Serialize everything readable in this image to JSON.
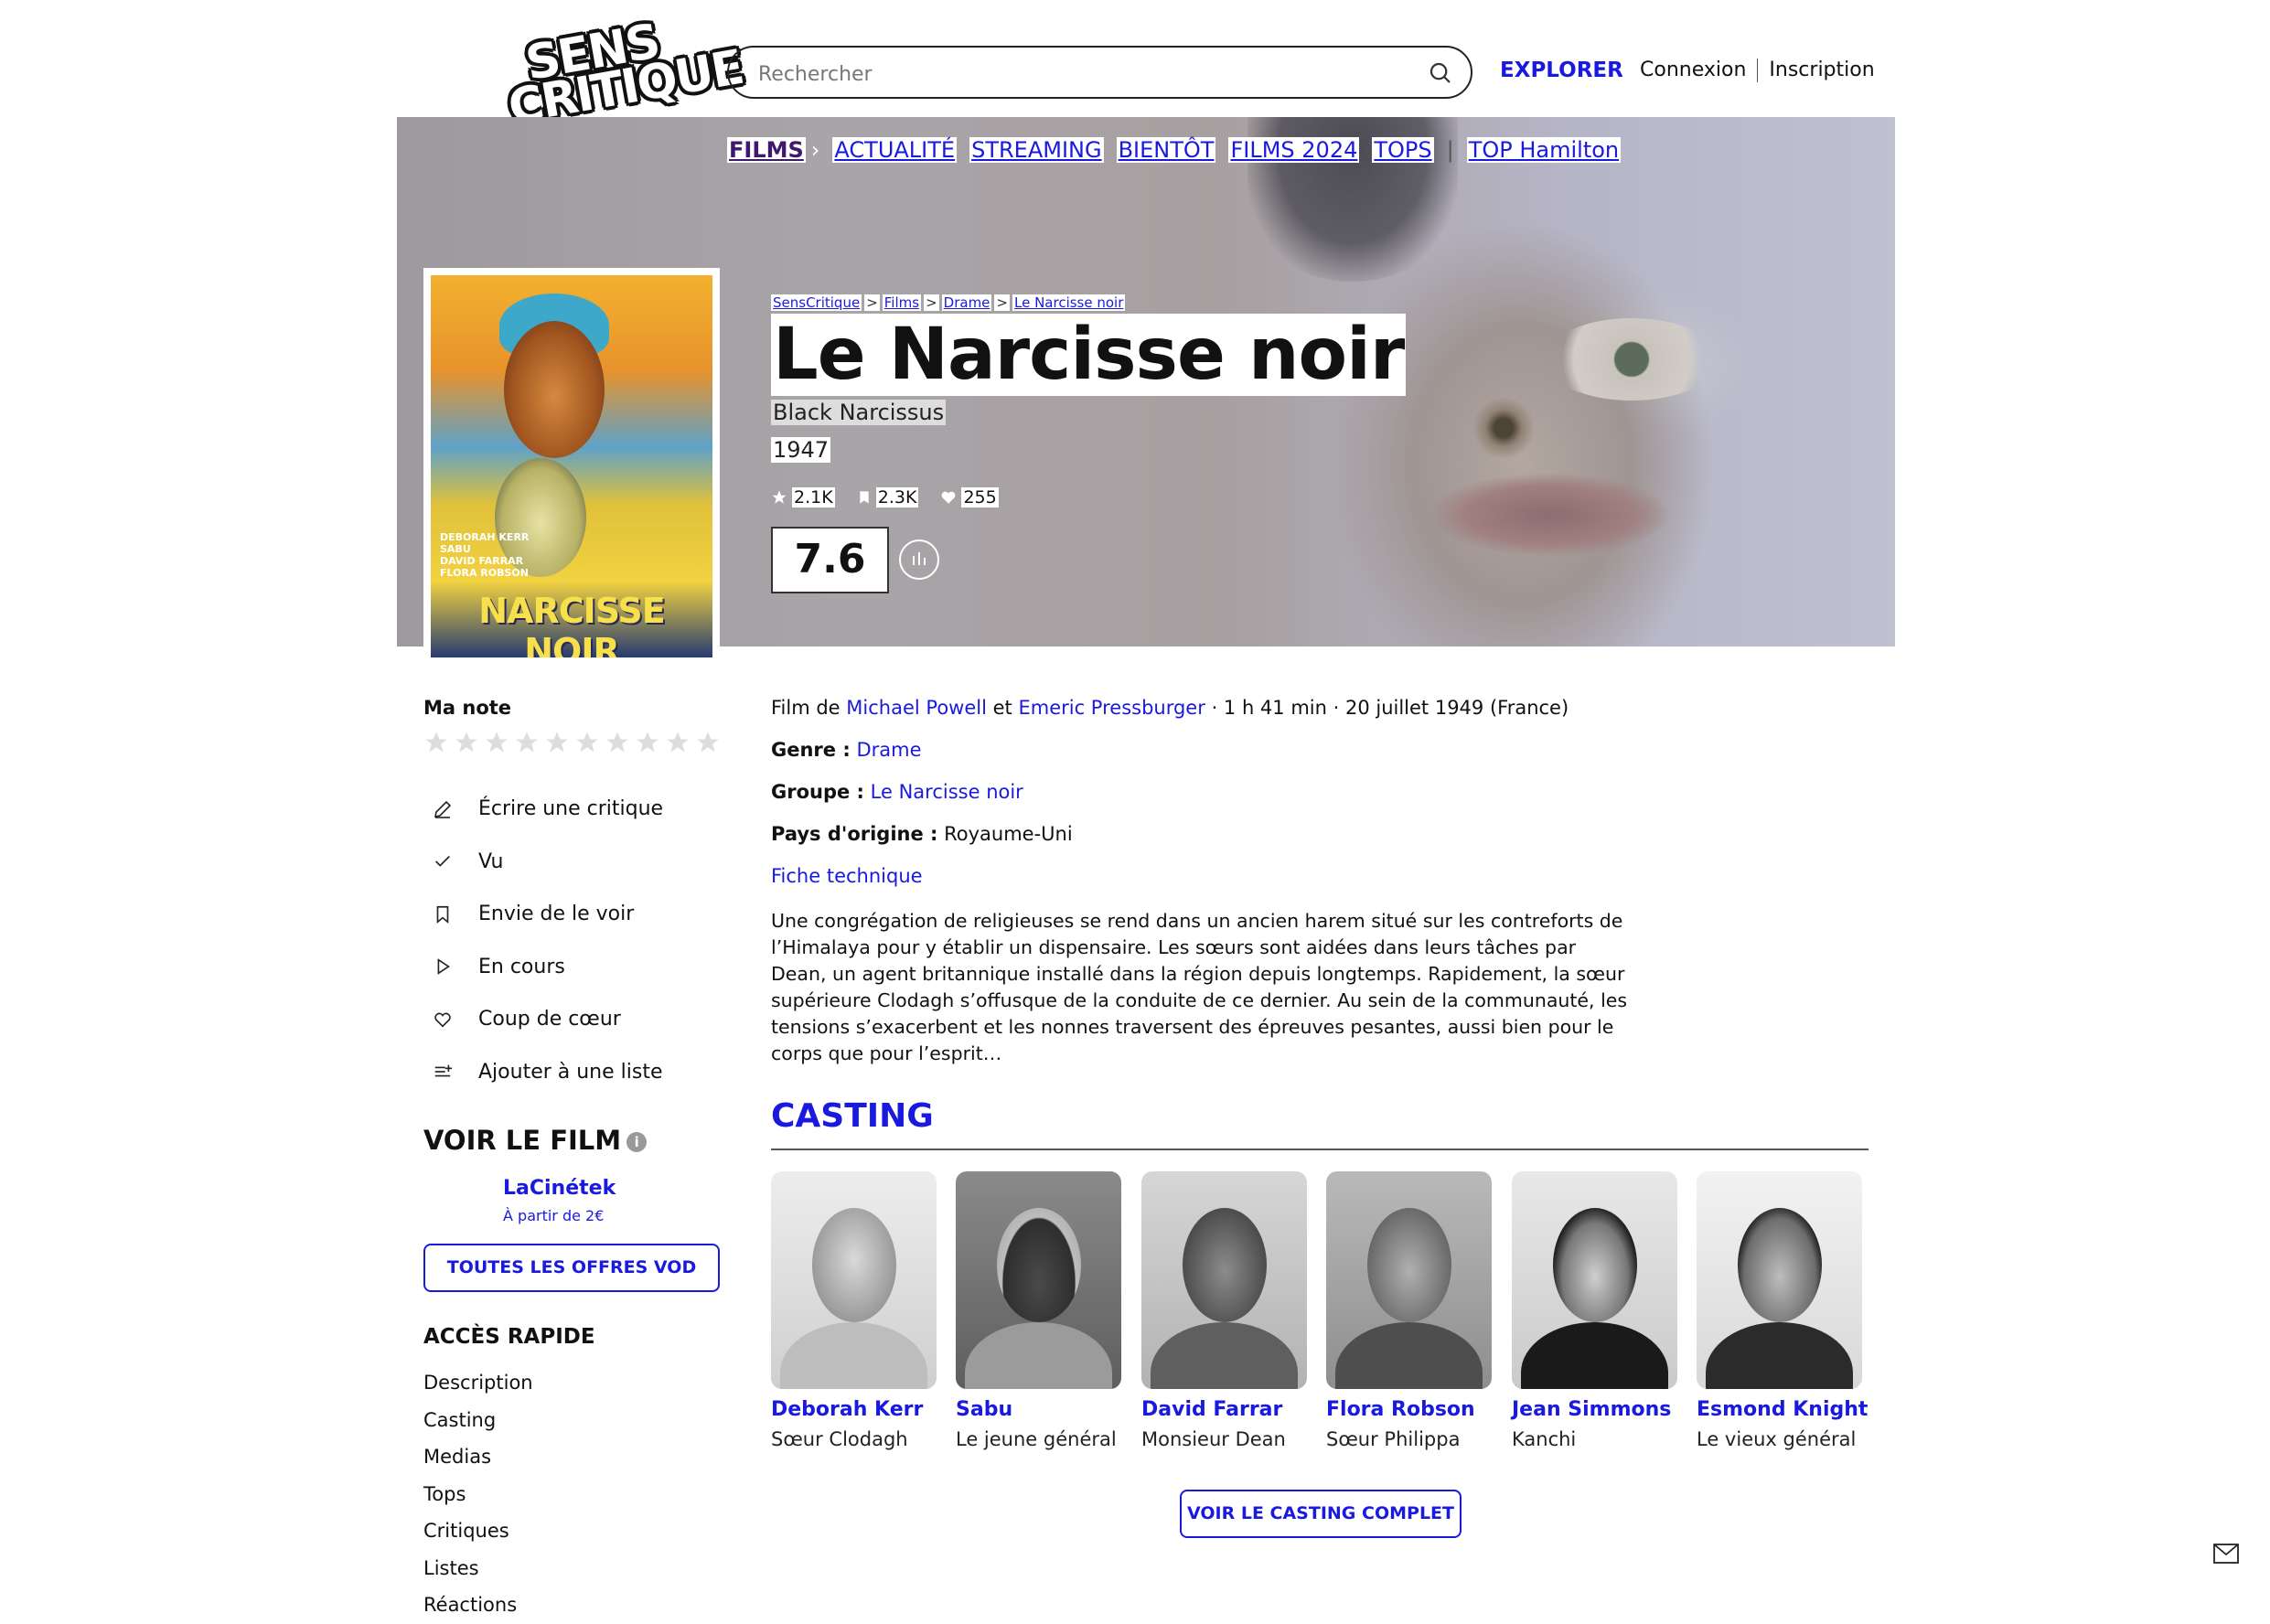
{
  "header": {
    "logo_line1": "SENS",
    "logo_line2": "CRITIQUE",
    "search_placeholder": "Rechercher",
    "explorer": "EXPLORER",
    "login": "Connexion",
    "signup": "Inscription"
  },
  "nav": {
    "films": "FILMS",
    "items": [
      "ACTUALITÉ",
      "STREAMING",
      "BIENTÔT",
      "FILMS 2024",
      "TOPS"
    ],
    "extra": "TOP Hamilton"
  },
  "breadcrumb": [
    "SensCritique",
    "Films",
    "Drame",
    "Le Narcisse noir"
  ],
  "film": {
    "title": "Le Narcisse noir",
    "original_title": "Black Narcissus",
    "year": "1947",
    "ratings_count": "2.1K",
    "wishlist_count": "2.3K",
    "favorites_count": "255",
    "score": "7.6"
  },
  "poster": {
    "title_text": "NARCISSE NOIR",
    "credits": [
      "DEBORAH KERR",
      "SABU",
      "DAVID FARRAR",
      "FLORA ROBSON"
    ]
  },
  "sidebar": {
    "ma_note": "Ma note",
    "actions": [
      {
        "icon": "pencil-icon",
        "label": "Écrire une critique"
      },
      {
        "icon": "check-icon",
        "label": "Vu"
      },
      {
        "icon": "bookmark-icon",
        "label": "Envie de le voir"
      },
      {
        "icon": "play-icon",
        "label": "En cours"
      },
      {
        "icon": "heart-icon",
        "label": "Coup de cœur"
      },
      {
        "icon": "list-add-icon",
        "label": "Ajouter à une liste"
      }
    ],
    "voir_le_film": "VOIR LE FILM",
    "provider": "LaCinétek",
    "provider_price": "À partir de 2€",
    "vod_button": "TOUTES LES OFFRES VOD",
    "acces_rapide": "ACCÈS RAPIDE",
    "acces_items": [
      "Description",
      "Casting",
      "Medias",
      "Tops",
      "Critiques",
      "Listes",
      "Réactions"
    ]
  },
  "details": {
    "film_de": "Film de",
    "director1": "Michael Powell",
    "et": "et",
    "director2": "Emeric Pressburger",
    "meta": "· 1 h 41 min · 20 juillet 1949 (France)",
    "genre_label": "Genre :",
    "genre": "Drame",
    "groupe_label": "Groupe :",
    "groupe": "Le Narcisse noir",
    "pays_label": "Pays d'origine :",
    "pays": "Royaume-Uni",
    "fiche": "Fiche technique",
    "synopsis": "Une congrégation de religieuses se rend dans un ancien harem situé sur les contreforts de l’Himalaya pour y établir un dispensaire. Les sœurs sont aidées dans leurs tâches par Dean, un agent britannique installé dans la région depuis longtemps. Rapidement, la sœur supérieure Clodagh s’offusque de la conduite de ce dernier. Au sein de la communauté, les tensions s’exacerbent et les nonnes traversent des épreuves pesantes, aussi bien pour le corps que pour l’esprit…"
  },
  "casting": {
    "title": "CASTING",
    "members": [
      {
        "name": "Deborah Kerr",
        "role": "Sœur Clodagh"
      },
      {
        "name": "Sabu",
        "role": "Le jeune général"
      },
      {
        "name": "David Farrar",
        "role": "Monsieur Dean"
      },
      {
        "name": "Flora Robson",
        "role": "Sœur Philippa"
      },
      {
        "name": "Jean Simmons",
        "role": "Kanchi"
      },
      {
        "name": "Esmond Knight",
        "role": "Le vieux général"
      }
    ],
    "full_button": "VOIR LE CASTING COMPLET"
  },
  "colors": {
    "link": "#1a1adf",
    "films_nav": "#3d1a6e"
  }
}
